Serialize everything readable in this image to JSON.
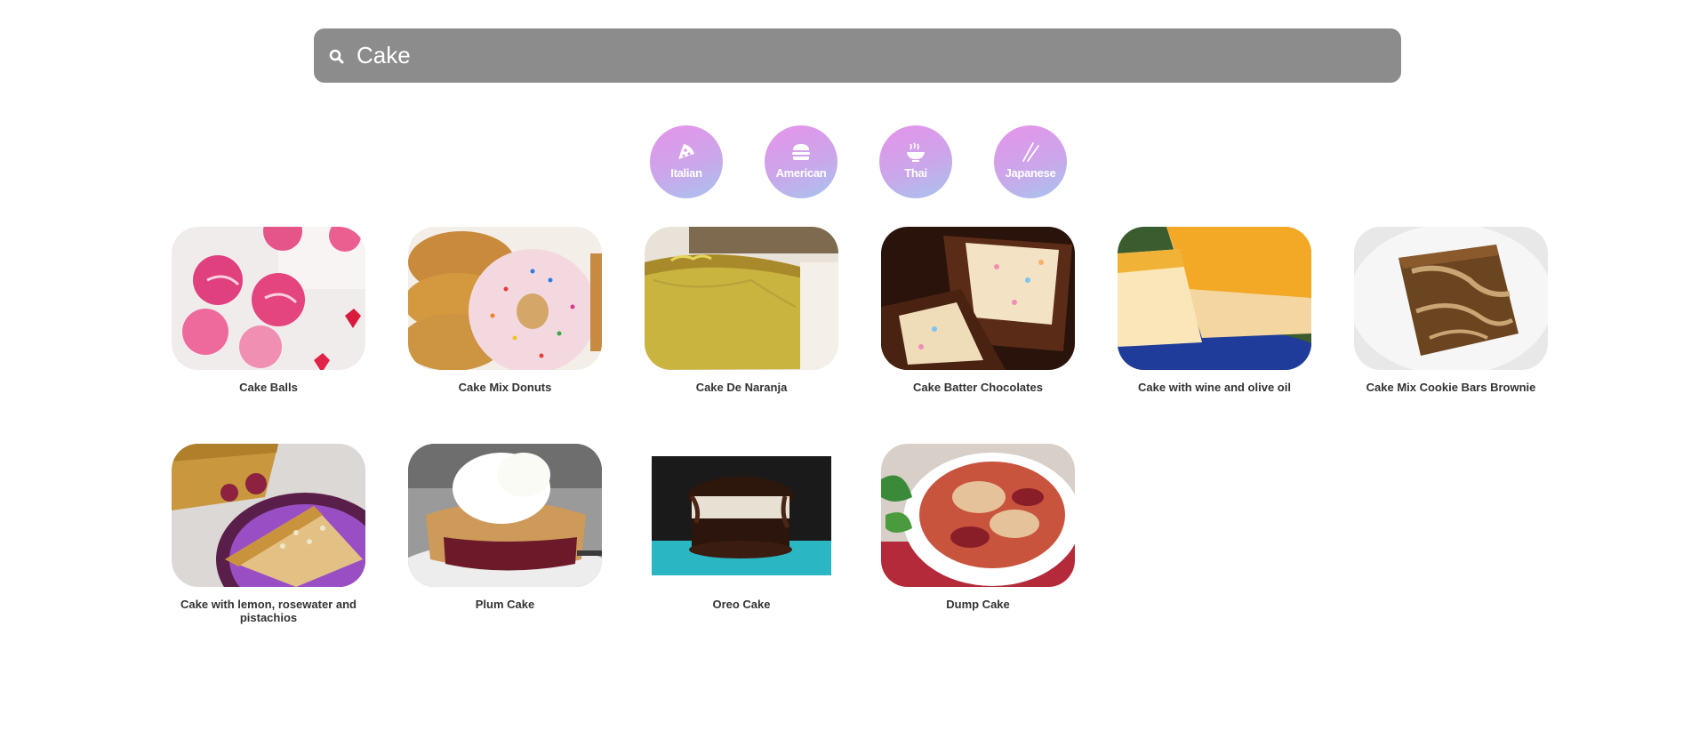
{
  "search": {
    "value": "Cake",
    "icon": "search-icon",
    "background": "#8c8c8c"
  },
  "cuisines": [
    {
      "label": "Italian",
      "icon": "pizza-icon"
    },
    {
      "label": "American",
      "icon": "burger-icon"
    },
    {
      "label": "Thai",
      "icon": "noodle-bowl-icon"
    },
    {
      "label": "Japanese",
      "icon": "chopsticks-icon"
    }
  ],
  "recipes": [
    {
      "title": "Cake Balls"
    },
    {
      "title": "Cake Mix Donuts"
    },
    {
      "title": "Cake De Naranja"
    },
    {
      "title": "Cake Batter Chocolates"
    },
    {
      "title": "Cake with wine and olive oil"
    },
    {
      "title": "Cake Mix Cookie Bars Brownie"
    },
    {
      "title": "Cake with lemon, rosewater and pistachios"
    },
    {
      "title": "Plum Cake"
    },
    {
      "title": "Oreo Cake"
    },
    {
      "title": "Dump Cake"
    }
  ],
  "colors": {
    "cuisine_gradient_start": "#e693ea",
    "cuisine_gradient_end": "#a7c4ee"
  }
}
